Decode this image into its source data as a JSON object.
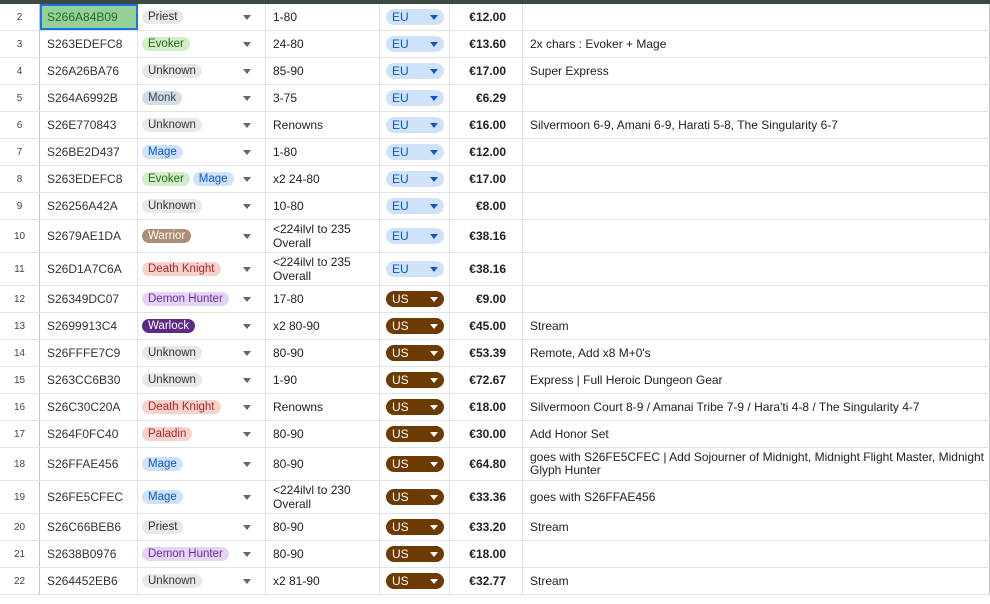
{
  "colors": {
    "Priest": {
      "bg": "#e8e8e8",
      "fg": "#333333"
    },
    "Evoker": {
      "bg": "#d5ecc8",
      "fg": "#1f6b1a"
    },
    "Unknown": {
      "bg": "#e8e8e8",
      "fg": "#333333"
    },
    "Monk": {
      "bg": "#d3dde3",
      "fg": "#2f4a5a"
    },
    "Mage": {
      "bg": "#cfe2f8",
      "fg": "#0b57d0"
    },
    "Warrior": {
      "bg": "#ae8e72",
      "fg": "#ffffff"
    },
    "Death Knight": {
      "bg": "#f7d3cf",
      "fg": "#b3261e"
    },
    "Demon Hunter": {
      "bg": "#e5d5f5",
      "fg": "#6c2ba8"
    },
    "Warlock": {
      "bg": "#5b2a86",
      "fg": "#ffffff"
    },
    "Paladin": {
      "bg": "#f7d3cf",
      "fg": "#b3261e"
    }
  },
  "rows": [
    {
      "n": "2",
      "id": "S266A84B09",
      "classes": [
        "Priest"
      ],
      "level": "1-80",
      "region": "EU",
      "price": "€12.00",
      "note": "",
      "selected": true
    },
    {
      "n": "3",
      "id": "S263EDEFC8",
      "classes": [
        "Evoker"
      ],
      "level": "24-80",
      "region": "EU",
      "price": "€13.60",
      "note": "2x chars : Evoker + Mage"
    },
    {
      "n": "4",
      "id": "S26A26BA76",
      "classes": [
        "Unknown"
      ],
      "level": "85-90",
      "region": "EU",
      "price": "€17.00",
      "note": "Super Express"
    },
    {
      "n": "5",
      "id": "S264A6992B",
      "classes": [
        "Monk"
      ],
      "level": "3-75",
      "region": "EU",
      "price": "€6.29",
      "note": ""
    },
    {
      "n": "6",
      "id": "S26E770843",
      "classes": [
        "Unknown"
      ],
      "level": "Renowns",
      "region": "EU",
      "price": "€16.00",
      "note": "Silvermoon 6-9, Amani 6-9, Harati 5-8, The Singularity 6-7"
    },
    {
      "n": "7",
      "id": "S26BE2D437",
      "classes": [
        "Mage"
      ],
      "level": "1-80",
      "region": "EU",
      "price": "€12.00",
      "note": ""
    },
    {
      "n": "8",
      "id": "S263EDEFC8",
      "classes": [
        "Evoker",
        "Mage"
      ],
      "level": "x2 24-80",
      "region": "EU",
      "price": "€17.00",
      "note": ""
    },
    {
      "n": "9",
      "id": "S26256A42A",
      "classes": [
        "Unknown"
      ],
      "level": "10-80",
      "region": "EU",
      "price": "€8.00",
      "note": ""
    },
    {
      "n": "10",
      "id": "S2679AE1DA",
      "classes": [
        "Warrior"
      ],
      "level": "<224ilvl to 235 Overall",
      "region": "EU",
      "price": "€38.16",
      "note": "",
      "tall": true
    },
    {
      "n": "11",
      "id": "S26D1A7C6A",
      "classes": [
        "Death Knight"
      ],
      "level": "<224ilvl to 235 Overall",
      "region": "EU",
      "price": "€38.16",
      "note": "",
      "tall": true
    },
    {
      "n": "12",
      "id": "S26349DC07",
      "classes": [
        "Demon Hunter"
      ],
      "level": "17-80",
      "region": "US",
      "price": "€9.00",
      "note": ""
    },
    {
      "n": "13",
      "id": "S2699913C4",
      "classes": [
        "Warlock"
      ],
      "level": "x2 80-90",
      "region": "US",
      "price": "€45.00",
      "note": "Stream"
    },
    {
      "n": "14",
      "id": "S26FFFE7C9",
      "classes": [
        "Unknown"
      ],
      "level": "80-90",
      "region": "US",
      "price": "€53.39",
      "note": "Remote, Add x8 M+0's"
    },
    {
      "n": "15",
      "id": "S263CC6B30",
      "classes": [
        "Unknown"
      ],
      "level": "1-90",
      "region": "US",
      "price": "€72.67",
      "note": "Express | Full Heroic Dungeon Gear"
    },
    {
      "n": "16",
      "id": "S26C30C20A",
      "classes": [
        "Death Knight"
      ],
      "level": "Renowns",
      "region": "US",
      "price": "€18.00",
      "note": "Silvermoon Court 8-9 /  Amanai Tribe 7-9 / Hara'ti 4-8 / The Singularity 4-7"
    },
    {
      "n": "17",
      "id": "S264F0FC40",
      "classes": [
        "Paladin"
      ],
      "level": "80-90",
      "region": "US",
      "price": "€30.00",
      "note": "Add Honor Set"
    },
    {
      "n": "18",
      "id": "S26FFAE456",
      "classes": [
        "Mage"
      ],
      "level": "80-90",
      "region": "US",
      "price": "€64.80",
      "note": "goes with S26FE5CFEC | Add Sojourner of Midnight, Midnight Flight Master, Midnight Glyph Hunter",
      "tall": true
    },
    {
      "n": "19",
      "id": "S26FE5CFEC",
      "classes": [
        "Mage"
      ],
      "level": "<224ilvl to 230 Overall",
      "region": "US",
      "price": "€33.36",
      "note": "goes with S26FFAE456",
      "tall": true
    },
    {
      "n": "20",
      "id": "S26C66BEB6",
      "classes": [
        "Priest"
      ],
      "level": "80-90",
      "region": "US",
      "price": "€33.20",
      "note": "Stream"
    },
    {
      "n": "21",
      "id": "S2638B0976",
      "classes": [
        "Demon Hunter"
      ],
      "level": "80-90",
      "region": "US",
      "price": "€18.00",
      "note": ""
    },
    {
      "n": "22",
      "id": "S264452EB6",
      "classes": [
        "Unknown"
      ],
      "level": "x2 81-90",
      "region": "US",
      "price": "€32.77",
      "note": "Stream"
    }
  ]
}
